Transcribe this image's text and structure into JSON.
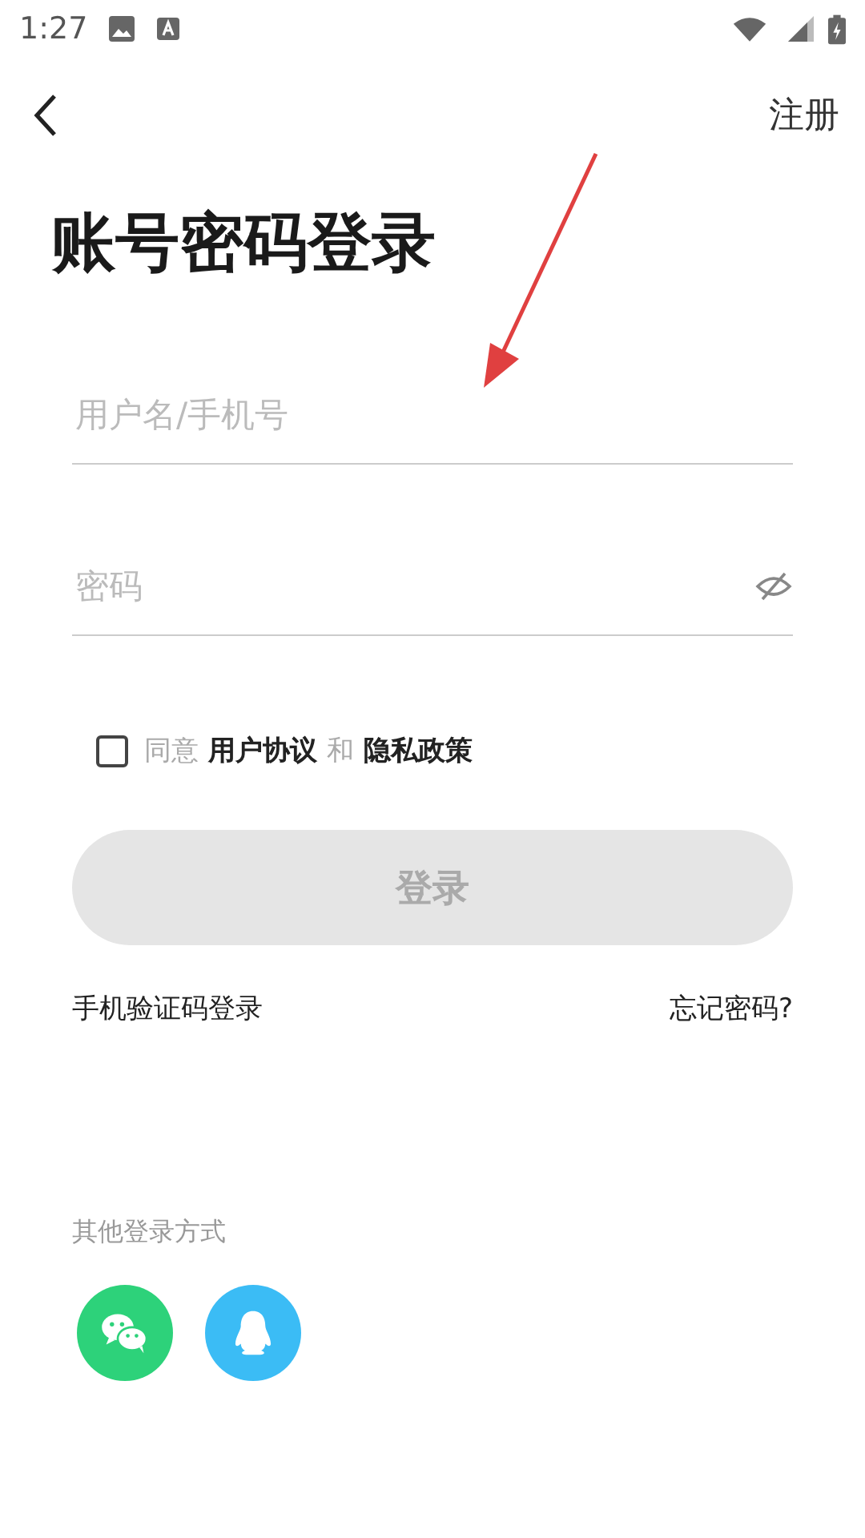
{
  "status_bar": {
    "time": "1:27"
  },
  "header": {
    "action": "注册"
  },
  "title": "账号密码登录",
  "fields": [
    {
      "kind": "text",
      "placeholder": "用户名/手机号"
    },
    {
      "kind": "password",
      "placeholder": "密码"
    }
  ],
  "agreement": {
    "checked": false,
    "prefix": "同意",
    "link_1": "用户协议",
    "joiner": "和",
    "link_2": "隐私政策"
  },
  "login_button": {
    "label": "登录",
    "disabled": true
  },
  "links": {
    "sms_login": "手机验证码登录",
    "forgot": "忘记密码?"
  },
  "other_login": {
    "label": "其他登录方式",
    "methods": [
      {
        "kind": "wechat",
        "color": "#2dd27a"
      },
      {
        "kind": "qq",
        "color": "#3bbcf5"
      }
    ]
  }
}
